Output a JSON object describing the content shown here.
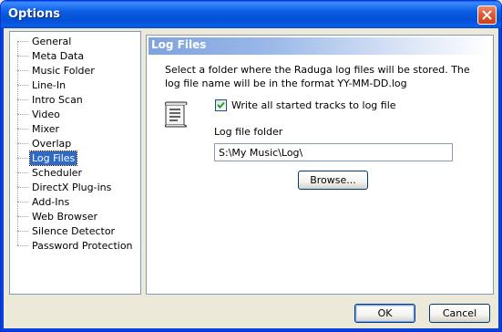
{
  "window": {
    "title": "Options"
  },
  "tree": {
    "items": [
      "General",
      "Meta Data",
      "Music Folder",
      "Line-In",
      "Intro Scan",
      "Video",
      "Mixer",
      "Overlap",
      "Log Files",
      "Scheduler",
      "DirectX Plug-ins",
      "Add-Ins",
      "Web Browser",
      "Silence Detector",
      "Password Protection"
    ],
    "selected": "Log Files"
  },
  "panel": {
    "header": "Log Files",
    "description": "Select a folder where the Raduga log files will be stored. The log file name will be in the format YY-MM-DD.log",
    "icon": "log-document-icon",
    "checkbox_label": "Write all started tracks to log file",
    "checkbox_checked": true,
    "folder_label": "Log file folder",
    "folder_value": "S:\\My Music\\Log\\",
    "browse_label": "Browse..."
  },
  "footer": {
    "ok_label": "OK",
    "cancel_label": "Cancel"
  },
  "colors": {
    "titlebar": "#0a5ce0",
    "selection": "#316ac5",
    "header_gradient_start": "#7fa3df"
  }
}
